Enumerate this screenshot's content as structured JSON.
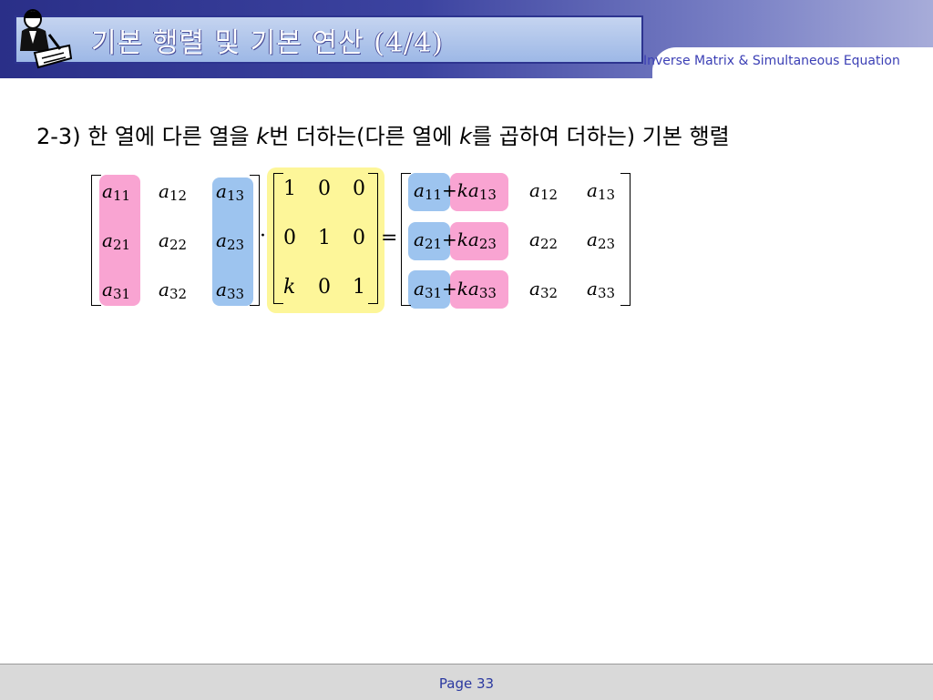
{
  "header": {
    "title": "기본 행렬 및 기본 연산 (4/4)",
    "subtitle": "Inverse Matrix & Simultaneous Equation",
    "logo_icon": "person-writing-icon"
  },
  "heading": {
    "part1": "2-3) 한 열에 다른 열을 ",
    "k1": "k",
    "part2": "번 더하는(다른 열에 ",
    "k2": "k",
    "part3": "를 곱하여 더하는) 기본 행렬"
  },
  "equation": {
    "matrix_a": [
      [
        "a",
        "11"
      ],
      [
        "a",
        "12"
      ],
      [
        "a",
        "13"
      ],
      [
        "a",
        "21"
      ],
      [
        "a",
        "22"
      ],
      [
        "a",
        "23"
      ],
      [
        "a",
        "31"
      ],
      [
        "a",
        "32"
      ],
      [
        "a",
        "33"
      ]
    ],
    "dot": "·",
    "elementary": [
      [
        "1",
        "0",
        "0"
      ],
      [
        "0",
        "1",
        "0"
      ],
      [
        "k",
        "0",
        "1"
      ]
    ],
    "equals": "=",
    "result": {
      "col1_plus": "+",
      "col1_ka": "ka",
      "rows": [
        "1",
        "2",
        "3"
      ]
    }
  },
  "highlight_colors": {
    "pink": "#f9a4d2",
    "blue": "#9dc4ef",
    "yellow": "#fdf699"
  },
  "footer": {
    "page": "Page 33"
  }
}
